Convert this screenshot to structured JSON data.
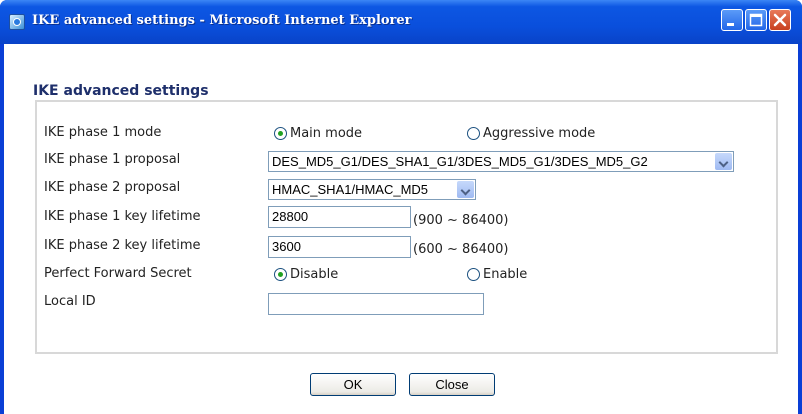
{
  "window": {
    "title": "IKE advanced settings - Microsoft Internet Explorer"
  },
  "heading": "IKE advanced settings",
  "form": {
    "phase1_mode": {
      "label": "IKE phase 1 mode",
      "options": [
        "Main mode",
        "Aggressive mode"
      ],
      "selected": "Main mode"
    },
    "phase1_proposal": {
      "label": "IKE phase 1 proposal",
      "value": "DES_MD5_G1/DES_SHA1_G1/3DES_MD5_G1/3DES_MD5_G2"
    },
    "phase2_proposal": {
      "label": "IKE phase 2 proposal",
      "value": "HMAC_SHA1/HMAC_MD5"
    },
    "phase1_lifetime": {
      "label": "IKE phase 1 key lifetime",
      "value": "28800",
      "range": "(900 ~ 86400)"
    },
    "phase2_lifetime": {
      "label": "IKE phase 2 key lifetime",
      "value": "3600",
      "range": "(600 ~ 86400)"
    },
    "pfs": {
      "label": "Perfect Forward Secret",
      "options": [
        "Disable",
        "Enable"
      ],
      "selected": "Disable"
    },
    "local_id": {
      "label": "Local ID",
      "value": ""
    }
  },
  "buttons": {
    "ok": "OK",
    "close": "Close"
  }
}
